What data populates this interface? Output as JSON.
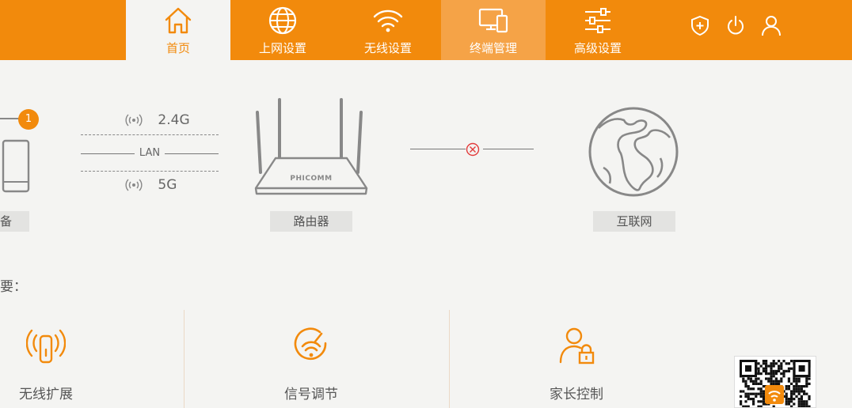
{
  "nav": {
    "tabs": [
      {
        "label": "首页",
        "icon": "home-icon"
      },
      {
        "label": "上网设置",
        "icon": "globe-icon"
      },
      {
        "label": "无线设置",
        "icon": "wifi-icon"
      },
      {
        "label": "终端管理",
        "icon": "devices-icon"
      },
      {
        "label": "高级设置",
        "icon": "sliders-icon"
      }
    ],
    "tools": [
      "shield-plus-icon",
      "power-icon",
      "user-icon"
    ]
  },
  "topology": {
    "device_count": "1",
    "device_label": "备",
    "band_24": "2.4G",
    "lan": "LAN",
    "band_5": "5G",
    "router_brand": "PHICOMM",
    "router_label": "路由器",
    "internet_label": "互联网"
  },
  "summary": {
    "title": "要："
  },
  "features": [
    {
      "label": "无线扩展",
      "icon": "wireless-extend-icon"
    },
    {
      "label": "信号调节",
      "icon": "signal-adjust-icon"
    },
    {
      "label": "家长控制",
      "icon": "parental-control-icon"
    }
  ],
  "colors": {
    "accent": "#f28a0c",
    "active_tab_bg": "#f4f4f2",
    "hover_tab_bg": "#f5a347",
    "disconnect": "#e23b3b"
  }
}
